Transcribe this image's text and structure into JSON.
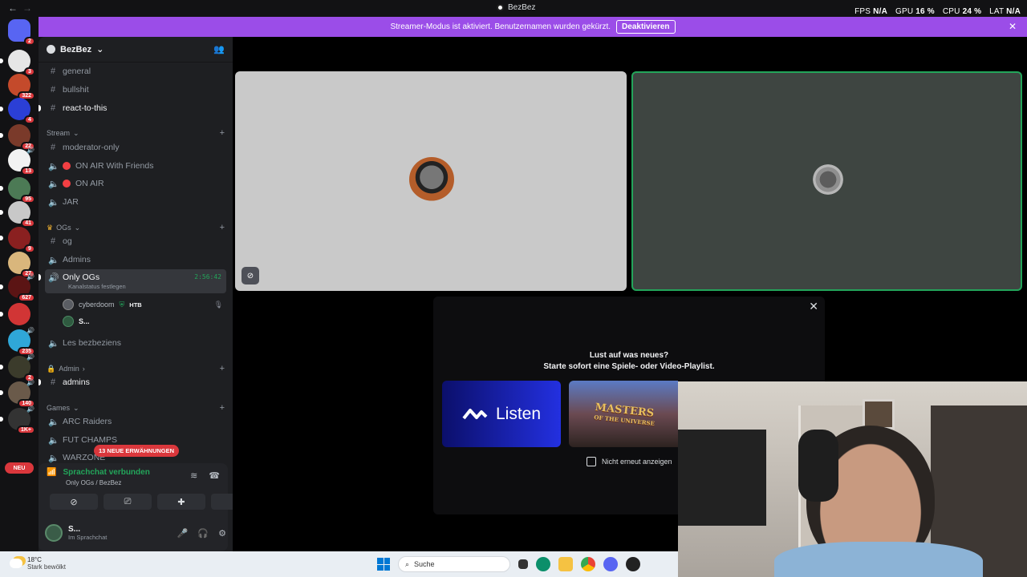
{
  "window": {
    "title": "BezBez"
  },
  "overlay": {
    "fps_label": "FPS",
    "fps": "N/A",
    "gpu_label": "GPU",
    "gpu": "16 %",
    "cpu_label": "CPU",
    "cpu": "24 %",
    "lat_label": "LAT",
    "lat": "N/A"
  },
  "banner": {
    "text": "Streamer-Modus ist aktiviert. Benutzernamen wurden gekürzt.",
    "button": "Deaktivieren"
  },
  "rail": {
    "badges": [
      "2",
      "3",
      "322",
      "4",
      "22",
      "13",
      "95",
      "41",
      "9",
      "27",
      "627",
      "235",
      "2",
      "140",
      "1K+"
    ],
    "new_label": "NEU"
  },
  "guild": {
    "name": "BezBez"
  },
  "channels": {
    "top": [
      "general",
      "bullshit",
      "react-to-this"
    ],
    "cat_stream": "Stream",
    "stream": [
      "moderator-only",
      "ON AIR With Friends",
      "ON AIR",
      "JAR"
    ],
    "cat_ogs": "OGs",
    "ogs": [
      "og",
      "Admins"
    ],
    "active": {
      "name": "Only OGs",
      "status": "Kanalstatus festlegen",
      "timer": "2:56:42"
    },
    "voice_users": [
      {
        "name": "cyberdoom",
        "tag": "HTB"
      },
      {
        "name": "S..."
      }
    ],
    "after": "Les bezbeziens",
    "cat_admin": "Admin",
    "admin": [
      "admins"
    ],
    "cat_games": "Games",
    "games": [
      "ARC Raiders",
      "FUT CHAMPS",
      "WARZONE"
    ],
    "mentions": "13 NEUE ERWÄHNUNGEN"
  },
  "voice_panel": {
    "status": "Sprachchat verbunden",
    "location": "Only OGs / BezBez",
    "user": "S...",
    "user_status": "Im Sprachchat"
  },
  "popup": {
    "line1": "Lust auf was neues?",
    "line2": "Starte sofort eine Spiele- oder Video-Playlist.",
    "listen": "Listen",
    "motu_line1": "MASTERS",
    "motu_line2": "OF THE UNIVERSE",
    "dont_show": "Nicht erneut anzeigen"
  },
  "taskbar": {
    "temp": "18°C",
    "weather": "Stark bewölkt",
    "search": "Suche"
  }
}
